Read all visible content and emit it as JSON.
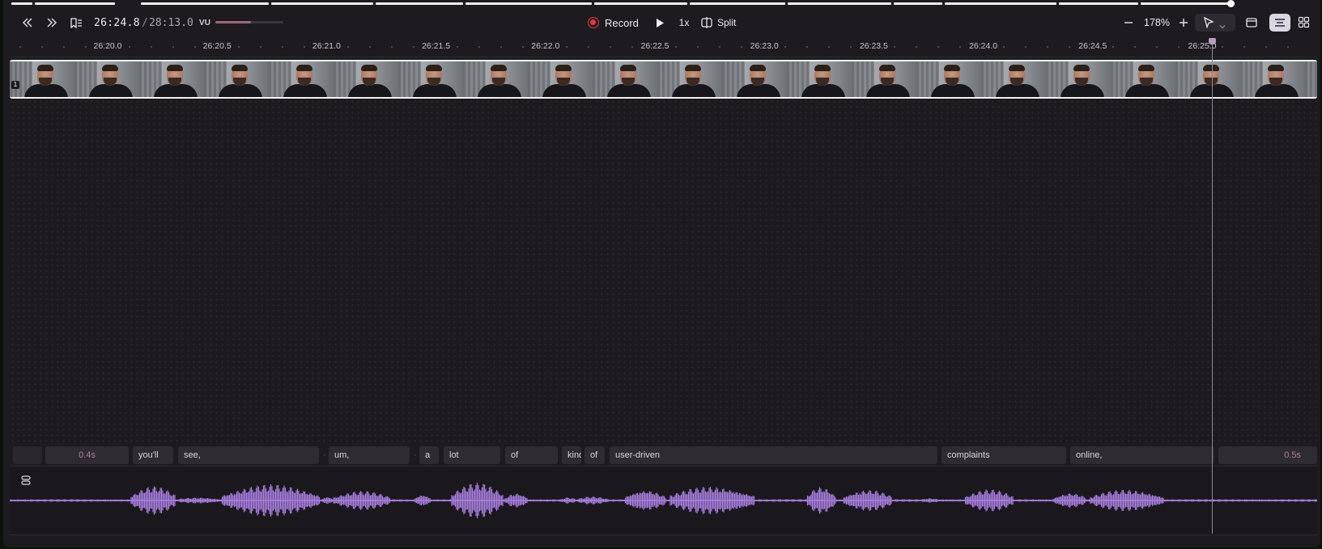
{
  "toolbar": {
    "rewind_icon": "chevrons-left-icon",
    "forward_icon": "chevrons-right-icon",
    "chapters_icon": "bookmark-list-icon",
    "current_time": "26:24.8",
    "separator": "/",
    "total_time": "28:13.0",
    "vu_label": "VU",
    "vu_level": 0.52,
    "record_label": "Record",
    "play_icon": "play-icon",
    "speed_label": "1x",
    "split_label": "Split",
    "zoom_out_icon": "minus-icon",
    "zoom_level": "178%",
    "zoom_in_icon": "plus-icon",
    "select_tool_icon": "cursor-arrow-icon",
    "layout_icons": [
      "single-view-icon",
      "list-view-icon",
      "grid-view-icon"
    ],
    "record_color": "#e23b3b"
  },
  "ruler": {
    "ticks": [
      "26:20.0",
      "26:20.5",
      "26:21.0",
      "26:21.5",
      "26:22.0",
      "26:22.5",
      "26:23.0",
      "26:23.5",
      "26:24.0",
      "26:24.5",
      "26:25.0"
    ]
  },
  "video_track": {
    "clip_number": "1",
    "frame_count": 21
  },
  "transcript": {
    "words": [
      {
        "text": "",
        "kind": "blank"
      },
      {
        "text": "0.4s",
        "kind": "gap"
      },
      {
        "text": "you'll",
        "kind": "word"
      },
      {
        "text": "see,",
        "kind": "word"
      },
      {
        "text": "um,",
        "kind": "word"
      },
      {
        "text": "a",
        "kind": "word"
      },
      {
        "text": "lot",
        "kind": "word"
      },
      {
        "text": "of",
        "kind": "word"
      },
      {
        "text": "kind",
        "kind": "word"
      },
      {
        "text": "of",
        "kind": "word"
      },
      {
        "text": "user-driven",
        "kind": "word"
      },
      {
        "text": "complaints",
        "kind": "word"
      },
      {
        "text": "online,",
        "kind": "word"
      },
      {
        "text": "0.5s",
        "kind": "gap"
      }
    ]
  },
  "audio_track": {
    "icon": "audio-track-icon",
    "wave_color": "#a97fe0"
  }
}
